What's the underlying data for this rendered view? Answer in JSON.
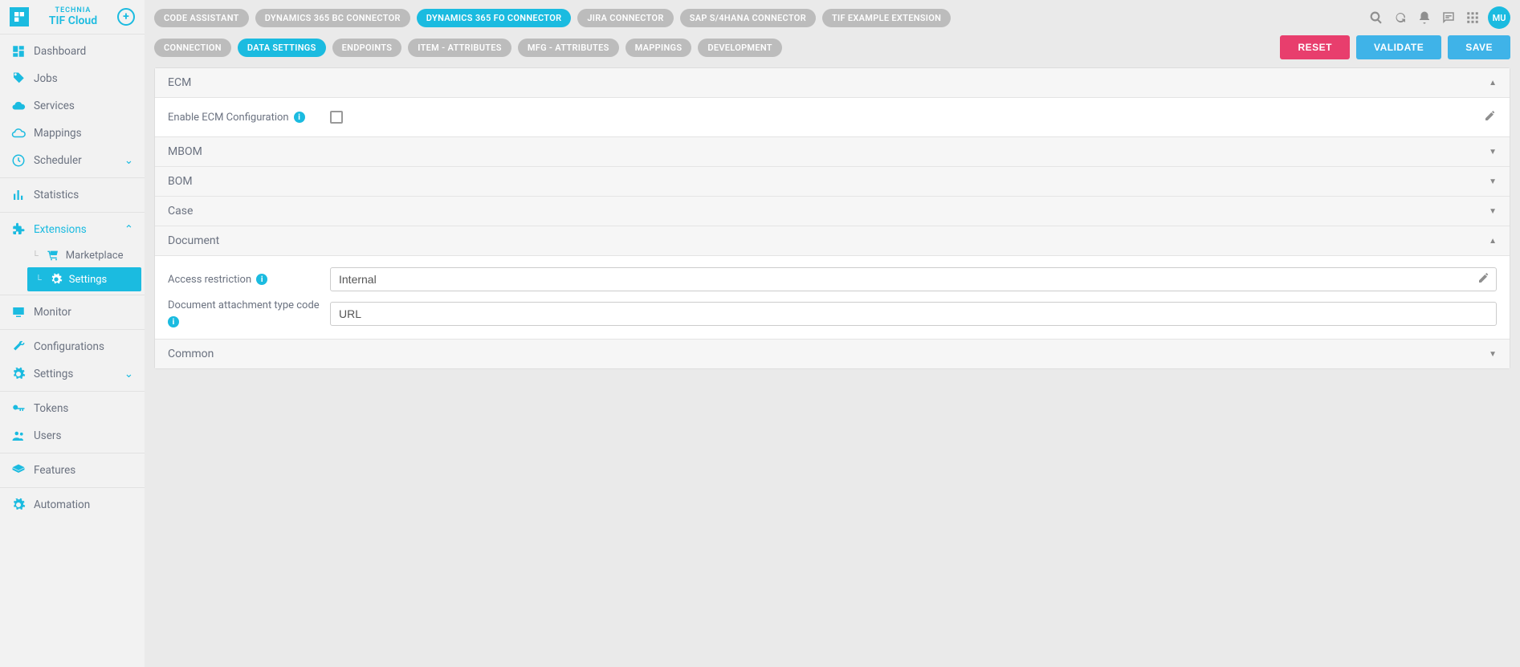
{
  "brand": {
    "company": "TECHNIA",
    "product": "TIF Cloud"
  },
  "sidebar": {
    "dashboard": "Dashboard",
    "jobs": "Jobs",
    "services": "Services",
    "mappings": "Mappings",
    "scheduler": "Scheduler",
    "statistics": "Statistics",
    "extensions": "Extensions",
    "marketplace": "Marketplace",
    "ext_settings": "Settings",
    "monitor": "Monitor",
    "configurations": "Configurations",
    "settings": "Settings",
    "tokens": "Tokens",
    "users": "Users",
    "features": "Features",
    "automation": "Automation"
  },
  "top_tabs": [
    "CODE ASSISTANT",
    "DYNAMICS 365 BC CONNECTOR",
    "DYNAMICS 365 FO CONNECTOR",
    "JIRA CONNECTOR",
    "SAP S/4HANA CONNECTOR",
    "TIF EXAMPLE EXTENSION"
  ],
  "top_tabs_active": 2,
  "sub_tabs": [
    "CONNECTION",
    "DATA SETTINGS",
    "ENDPOINTS",
    "ITEM - ATTRIBUTES",
    "MFG - ATTRIBUTES",
    "MAPPINGS",
    "DEVELOPMENT"
  ],
  "sub_tabs_active": 1,
  "buttons": {
    "reset": "RESET",
    "validate": "VALIDATE",
    "save": "SAVE"
  },
  "avatar": "MU",
  "sections": {
    "ecm": {
      "title": "ECM",
      "enable_label": "Enable ECM Configuration"
    },
    "mbom": "MBOM",
    "bom": "BOM",
    "case": "Case",
    "document": {
      "title": "Document",
      "access_label": "Access restriction",
      "access_value": "Internal",
      "attach_label": "Document attachment type code",
      "attach_value": "URL"
    },
    "common": "Common"
  }
}
